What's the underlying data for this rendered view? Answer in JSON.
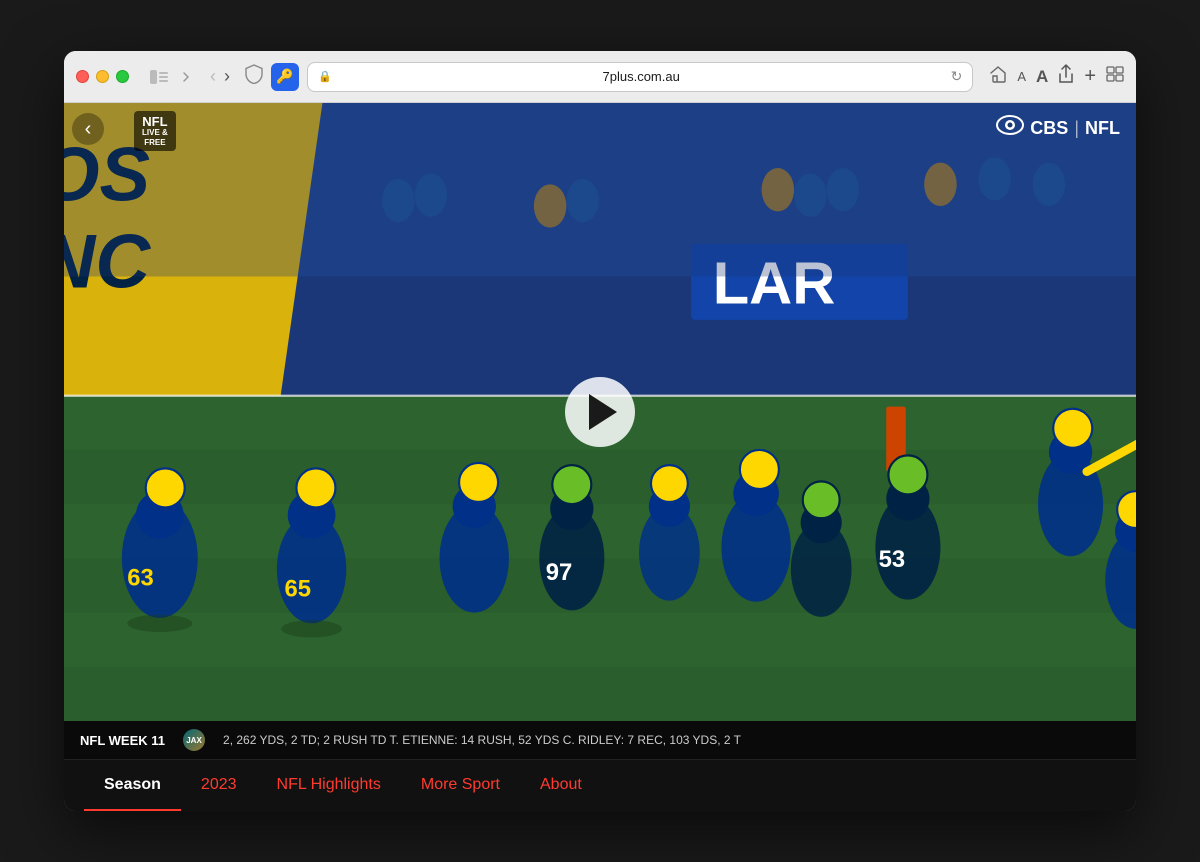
{
  "window": {
    "title": "7plus.com.au",
    "url": "7plus.com.au",
    "scheme": "🔒"
  },
  "browser": {
    "back_disabled": true,
    "forward_disabled": false,
    "refresh_label": "↻",
    "back_label": "‹",
    "forward_label": "›",
    "share_label": "⬆",
    "add_tab_label": "+",
    "tab_overview_label": "⧉",
    "reading_mode_label": "⊟",
    "font_small": "A",
    "font_large": "A"
  },
  "video": {
    "nfl_badge": "NFL",
    "nfl_sub1": "LIVE &",
    "nfl_sub2": "FREE",
    "cbs_label": "CBS | NFL",
    "back_label": "‹",
    "play_label": "▶"
  },
  "ticker": {
    "week_label": "NFL WEEK 11",
    "text": "2, 262 YDS, 2 TD; 2 RUSH TD    T. ETIENNE: 14 RUSH, 52 YDS    C. RIDLEY: 7 REC, 103 YDS, 2 T"
  },
  "nav": {
    "tabs": [
      {
        "id": "season",
        "label": "Season",
        "active": true
      },
      {
        "id": "year",
        "label": "2023",
        "active": false
      },
      {
        "id": "highlights",
        "label": "NFL Highlights",
        "active": false
      },
      {
        "id": "more",
        "label": "More Sport",
        "active": false
      },
      {
        "id": "about",
        "label": "About",
        "active": false
      }
    ]
  },
  "colors": {
    "accent": "#ff3b30",
    "background": "#0a0a0a",
    "text_primary": "#ffffff",
    "text_secondary": "#cccccc"
  }
}
